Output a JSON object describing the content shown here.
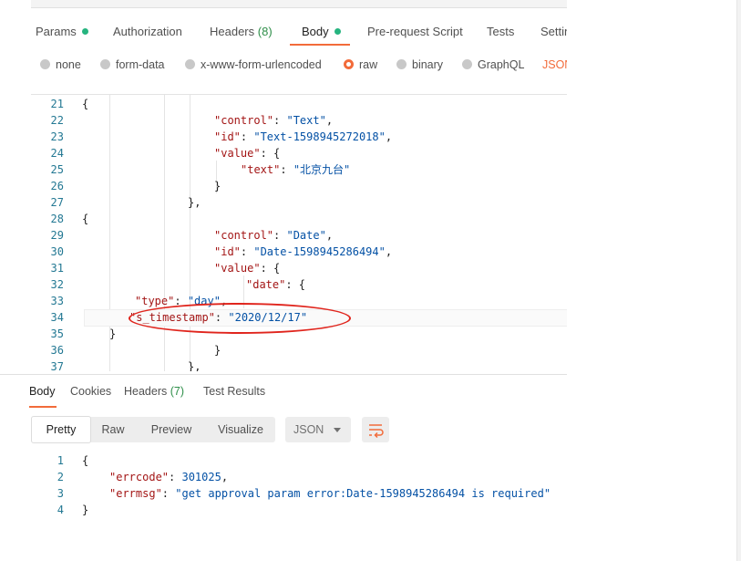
{
  "request_tabs": [
    {
      "label": "Params",
      "dot": true
    },
    {
      "label": "Authorization"
    },
    {
      "label": "Headers",
      "count": "(8)"
    },
    {
      "label": "Body",
      "dot": true,
      "active": true
    },
    {
      "label": "Pre-request Script"
    },
    {
      "label": "Tests"
    },
    {
      "label": "Settin"
    }
  ],
  "body_types": [
    "none",
    "form-data",
    "x-www-form-urlencoded",
    "raw",
    "binary",
    "GraphQL"
  ],
  "body_type_selected": "raw",
  "body_format": "JSON",
  "request_editor": {
    "lines": [
      {
        "n": "21",
        "parts": [
          [
            "{",
            "p"
          ]
        ]
      },
      {
        "n": "22",
        "parts": [
          [
            "\"control\"",
            "k"
          ],
          [
            ": ",
            "p"
          ],
          [
            "\"Text\"",
            "s"
          ],
          [
            ",",
            "p"
          ]
        ]
      },
      {
        "n": "23",
        "parts": [
          [
            "\"id\"",
            "k"
          ],
          [
            ": ",
            "p"
          ],
          [
            "\"Text-1598945272018\"",
            "s"
          ],
          [
            ",",
            "p"
          ]
        ]
      },
      {
        "n": "24",
        "parts": [
          [
            "\"value\"",
            "k"
          ],
          [
            ": {",
            "p"
          ]
        ]
      },
      {
        "n": "25",
        "parts": [
          [
            "\"text\"",
            "k"
          ],
          [
            ": ",
            "p"
          ],
          [
            "\"北京九台\"",
            "s"
          ]
        ]
      },
      {
        "n": "26",
        "parts": [
          [
            "}",
            "p"
          ]
        ]
      },
      {
        "n": "27",
        "parts": [
          [
            "},",
            "p"
          ]
        ]
      },
      {
        "n": "28",
        "parts": [
          [
            "{",
            "p"
          ]
        ]
      },
      {
        "n": "29",
        "parts": [
          [
            "\"control\"",
            "k"
          ],
          [
            ": ",
            "p"
          ],
          [
            "\"Date\"",
            "s"
          ],
          [
            ",",
            "p"
          ]
        ]
      },
      {
        "n": "30",
        "parts": [
          [
            "\"id\"",
            "k"
          ],
          [
            ": ",
            "p"
          ],
          [
            "\"Date-1598945286494\"",
            "s"
          ],
          [
            ",",
            "p"
          ]
        ]
      },
      {
        "n": "31",
        "parts": [
          [
            "\"value\"",
            "k"
          ],
          [
            ": {",
            "p"
          ]
        ]
      },
      {
        "n": "32",
        "parts": [
          [
            "\"date\"",
            "k"
          ],
          [
            ": {",
            "p"
          ]
        ]
      },
      {
        "n": "33",
        "parts": [
          [
            "\"type\"",
            "k"
          ],
          [
            ": ",
            "p"
          ],
          [
            "\"day\"",
            "s"
          ],
          [
            ",",
            "p"
          ]
        ]
      },
      {
        "n": "34",
        "parts": [
          [
            "\"s_timestamp\"",
            "k"
          ],
          [
            ": ",
            "p"
          ],
          [
            "\"2020/12/17\"",
            "s"
          ]
        ]
      },
      {
        "n": "35",
        "parts": [
          [
            "}",
            "p"
          ]
        ]
      },
      {
        "n": "36",
        "parts": [
          [
            "}",
            "p"
          ]
        ]
      },
      {
        "n": "37",
        "parts": [
          [
            "},",
            "p"
          ]
        ]
      }
    ]
  },
  "response_tabs": [
    {
      "label": "Body",
      "active": true
    },
    {
      "label": "Cookies"
    },
    {
      "label": "Headers",
      "count": "(7)"
    },
    {
      "label": "Test Results"
    }
  ],
  "response_views": [
    "Pretty",
    "Raw",
    "Preview",
    "Visualize"
  ],
  "response_view_selected": "Pretty",
  "response_format": "JSON",
  "response_body": {
    "lines": [
      {
        "n": "1",
        "parts": [
          [
            "{",
            "p"
          ]
        ]
      },
      {
        "n": "2",
        "parts": [
          [
            "\"errcode\"",
            "k"
          ],
          [
            ": ",
            "p"
          ],
          [
            "301025",
            "s"
          ],
          [
            ",",
            "p"
          ]
        ]
      },
      {
        "n": "3",
        "parts": [
          [
            "\"errmsg\"",
            "k"
          ],
          [
            ": ",
            "p"
          ],
          [
            "\"get approval param error:Date-1598945286494 is required\"",
            "s"
          ]
        ]
      },
      {
        "n": "4",
        "parts": [
          [
            "}",
            "p"
          ]
        ]
      }
    ]
  },
  "colors": {
    "accent": "#f26b3a",
    "dot": "#26b47f",
    "key": "#a31515",
    "string": "#0451a5",
    "annotation": "#e0251d"
  },
  "icons": [
    "wrap-lines-icon",
    "chevron-down-icon"
  ]
}
